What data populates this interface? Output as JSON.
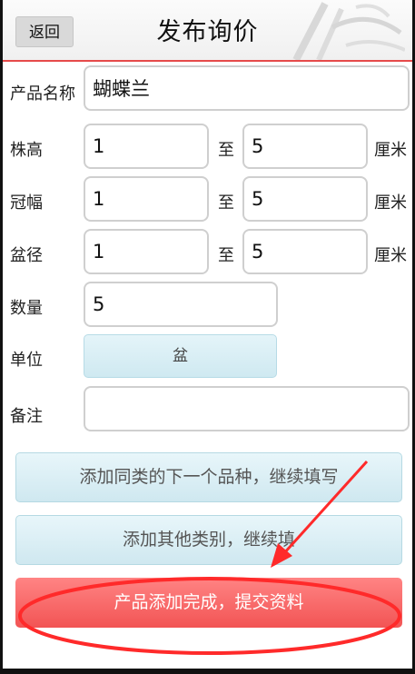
{
  "header": {
    "back_label": "返回",
    "title": "发布询价"
  },
  "form": {
    "product_name": {
      "label": "产品名称",
      "value": "蝴蝶兰"
    },
    "plant_height": {
      "label": "株高",
      "min": "1",
      "to": "至",
      "max": "5",
      "unit": "厘米"
    },
    "crown_width": {
      "label": "冠幅",
      "min": "1",
      "to": "至",
      "max": "5",
      "unit": "厘米"
    },
    "pot_diameter": {
      "label": "盆径",
      "min": "1",
      "to": "至",
      "max": "5",
      "unit": "厘米"
    },
    "quantity": {
      "label": "数量",
      "value": "5"
    },
    "unit": {
      "label": "单位",
      "value": "盆"
    },
    "remark": {
      "label": "备注",
      "value": ""
    }
  },
  "actions": {
    "add_same_label": "添加同类的下一个品种，继续填写",
    "add_other_label": "添加其他类别，继续填",
    "submit_label": "产品添加完成，提交资料"
  },
  "colors": {
    "accent_red": "#f25454",
    "button_blue": "#cfe8f0",
    "annotation_red": "#ff2a2a"
  }
}
